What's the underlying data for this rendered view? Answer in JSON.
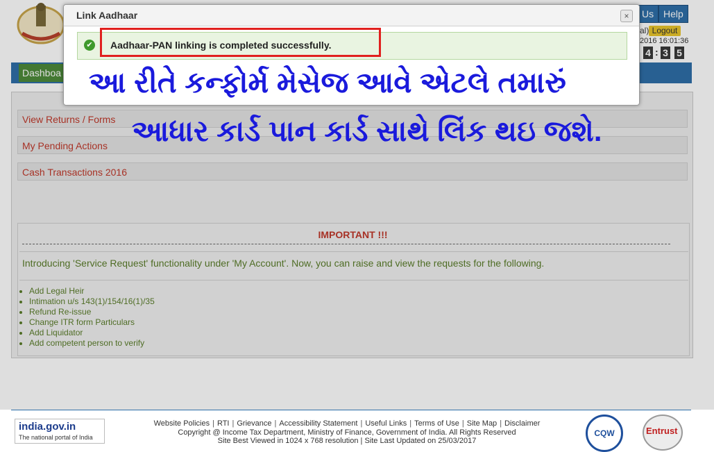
{
  "header": {
    "partial_button": "Us",
    "help": "Help",
    "partial_text": "al)",
    "logout": "Logout",
    "datetime": "2016 16:01:36",
    "timer_digits": [
      "4",
      "3",
      "5"
    ]
  },
  "nav": {
    "dashboard": "Dashboa"
  },
  "panels": [
    "View Returns / Forms",
    "My Pending Actions",
    "Cash Transactions 2016"
  ],
  "important": {
    "title": "IMPORTANT !!!",
    "intro": "Introducing 'Service Request' functionality under 'My Account'. Now, you can raise and view the requests for the following.",
    "items": [
      "Add Legal Heir",
      "Intimation u/s 143(1)/154/16(1)/35",
      "Refund Re-issue",
      "Change ITR form Particulars",
      "Add Liquidator",
      "Add competent person to verify"
    ]
  },
  "modal": {
    "title": "Link Aadhaar",
    "close": "×",
    "message": "Aadhaar-PAN linking is completed successfully."
  },
  "annotation": {
    "line1": "આ રીતે કન્ફોર્મ મેસેજ આવે એટલે તમારું",
    "line2": "આધાર કાર્ડ પાન કાર્ડ સાથે લિંક થઇ જશે."
  },
  "footer": {
    "logo_main": "india.gov.in",
    "logo_sub": "The national portal of India",
    "links": [
      "Website Policies",
      "RTI",
      "Grievance",
      "Accessibility Statement",
      "Useful Links",
      "Terms of Use",
      "Site Map",
      "Disclaimer"
    ],
    "copyright": "Copyright @ Income Tax Department, Ministry of Finance, Government of India. All Rights Reserved",
    "best_viewed": "Site Best Viewed in 1024 x 768 resolution | Site Last Updated on 25/03/2017",
    "badge_cqw": "CQW",
    "badge_entrust": "Entrust"
  },
  "colors": {
    "nav_blue": "#2f6fa8",
    "dashboard_green": "#4e8a3a",
    "annotation_blue": "#1a1adc",
    "highlight_red": "#e0201e",
    "panel_text_red": "#c0392b",
    "important_text_green": "#5a7d2a"
  }
}
